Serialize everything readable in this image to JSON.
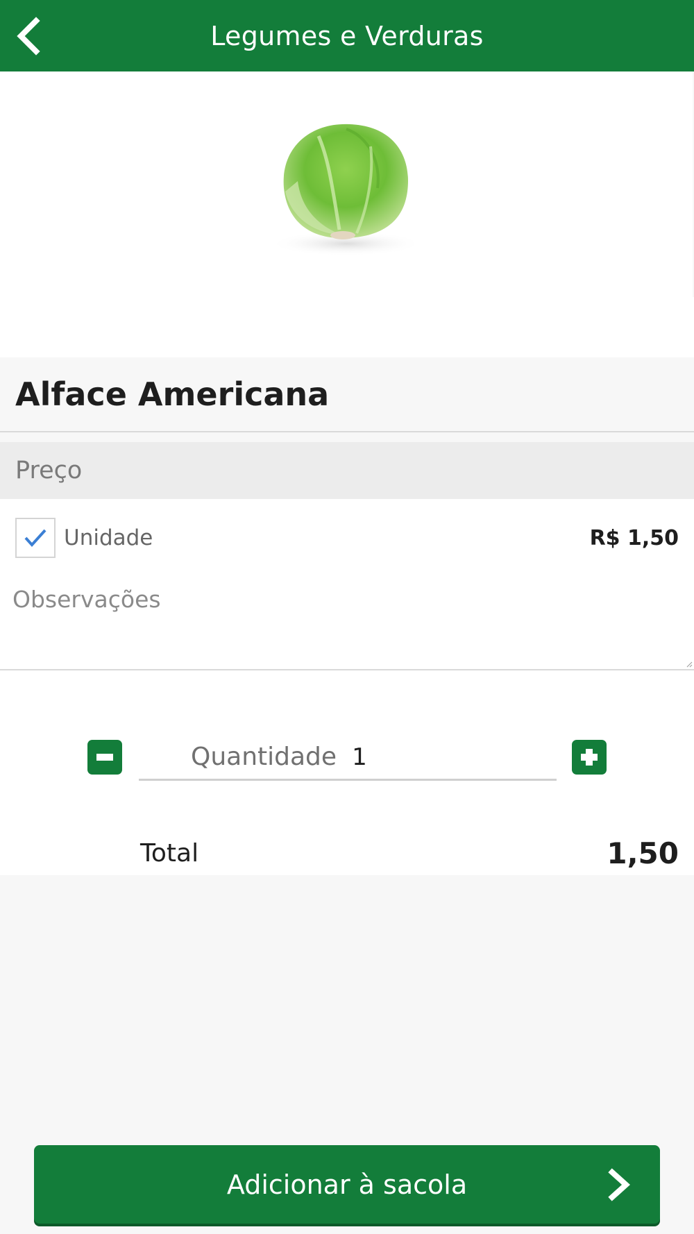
{
  "header": {
    "title": "Legumes e Verduras",
    "back_icon": "chevron-left-icon"
  },
  "product": {
    "name": "Alface Americana",
    "image": "lettuce-image"
  },
  "price_section": {
    "label": "Preço",
    "options": [
      {
        "label": "Unidade",
        "price": "R$ 1,50",
        "checked": true
      }
    ]
  },
  "notes": {
    "placeholder": "Observações",
    "value": ""
  },
  "quantity": {
    "label": "Quantidade",
    "value": "1",
    "minus_icon": "minus-icon",
    "plus_icon": "plus-icon"
  },
  "total": {
    "label": "Total",
    "value": "1,50"
  },
  "add_button": {
    "label": "Adicionar à sacola",
    "icon": "chevron-right-icon"
  },
  "colors": {
    "primary": "#137d3a",
    "checkmark": "#3b7fd4"
  }
}
